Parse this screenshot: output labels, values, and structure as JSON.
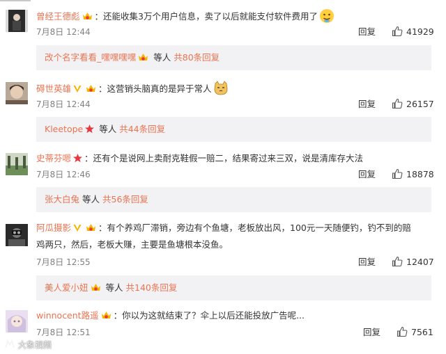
{
  "ui": {
    "reply_label": "回复",
    "date_prefix": "7月8日"
  },
  "comments": [
    {
      "username": "曾经王德彪",
      "text": "：还能收集3万个用户信息，卖了以后就能支付软件费用了",
      "time": "7月8日 12:44",
      "likes": "41929",
      "sub": {
        "first": "改个名字看看_嘿嘿嘿嘿",
        "etc": "等人",
        "more": "共80条回复"
      }
    },
    {
      "username": "碍世英雄",
      "text": "：这营销头脑真的是异于常人",
      "time": "7月8日 12:44",
      "likes": "26157",
      "sub": {
        "first": "Kleetope",
        "etc": "等人",
        "more": "共44条回复"
      }
    },
    {
      "username": "史蒂芬嗯",
      "text": "：还有个是说网上卖耐克鞋假一赔二，结果寄过来三双，说是清库存大法",
      "time": "7月8日 12:46",
      "likes": "18878",
      "sub": {
        "first": "张大白兔",
        "etc": "等人",
        "more": "共56条回复"
      }
    },
    {
      "username": "阿瓜摄影",
      "text_line1": "：有个养鸡厂滞销，旁边有个鱼塘，老板放出风，100元一天随便钓，钓不到的赔",
      "text_line2": "鸡两只，然后，老板大赚，主要是鱼塘根本没鱼。",
      "time": "7月8日 12:55",
      "likes": "12407",
      "sub": {
        "first": "美人爱小妞",
        "etc": "等人",
        "more": "共140条回复"
      }
    },
    {
      "username": "winnocent路遥",
      "text": "：你以为这就结束了？伞上以后还能投放广告呢...",
      "time": "7月8日 12:51",
      "likes": "7561"
    }
  ],
  "watermark": "大象视频",
  "colors": {
    "link": "#eb7350",
    "sub_bg": "#f2f2f5",
    "meta": "#808080",
    "vip_gold": "#f7b500",
    "badge_red": "#e8373e"
  },
  "icons": [
    "vip-crown-badge",
    "member-v-badge",
    "red-star-badge",
    "thumb-up-icon",
    "emoji-face"
  ]
}
